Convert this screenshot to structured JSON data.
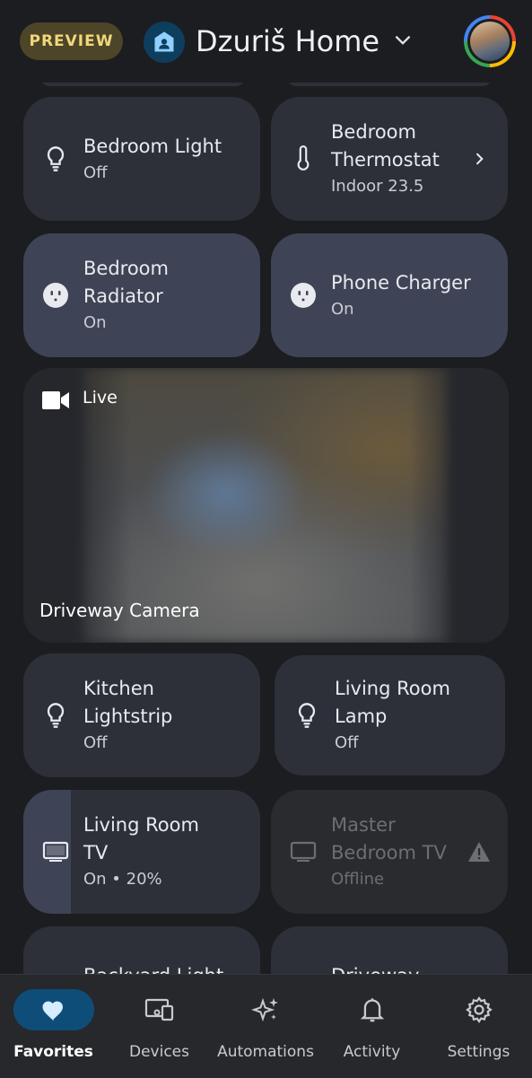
{
  "header": {
    "preview_label": "PREVIEW",
    "home_name": "Dzuriš Home",
    "home_icon": "home-person-icon",
    "menu_icon": "chevron-down-icon"
  },
  "tiles": [
    {
      "name": "Bedroom Light",
      "status": "Off",
      "icon": "lightbulb-icon",
      "state": "off"
    },
    {
      "name": "Bedroom Thermostat",
      "status": "Indoor 23.5",
      "icon": "thermometer-icon",
      "state": "off",
      "chevron": "chevron-right-icon"
    },
    {
      "name": "Bedroom Radiator",
      "status": "On",
      "icon": "outlet-icon",
      "state": "on"
    },
    {
      "name": "Phone Charger",
      "status": "On",
      "icon": "outlet-icon",
      "state": "on"
    },
    {
      "name": "Kitchen Lightstrip",
      "status": "Off",
      "icon": "lightbulb-icon",
      "state": "off"
    },
    {
      "name": "Living Room Lamp",
      "status": "Off",
      "icon": "lightbulb-icon",
      "state": "off"
    },
    {
      "name": "Living Room TV",
      "status": "On • 20%",
      "icon": "tv-icon",
      "state": "on",
      "level_percent": 20
    },
    {
      "name": "Master Bedroom TV",
      "status": "Offline",
      "icon": "tv-icon",
      "state": "offline",
      "alert_icon": "warning-icon"
    },
    {
      "name": "Backyard Light",
      "status": "",
      "icon": "lightbulb-icon",
      "state": "off"
    },
    {
      "name": "Driveway Lights",
      "status": "",
      "icon": "lightbulb-icon",
      "state": "off"
    }
  ],
  "camera": {
    "live_label": "Live",
    "name": "Driveway Camera",
    "icon": "video-camera-icon"
  },
  "nav": [
    {
      "label": "Favorites",
      "icon": "heart-icon",
      "active": true
    },
    {
      "label": "Devices",
      "icon": "devices-icon",
      "active": false
    },
    {
      "label": "Automations",
      "icon": "sparkle-icon",
      "active": false
    },
    {
      "label": "Activity",
      "icon": "bell-icon",
      "active": false
    },
    {
      "label": "Settings",
      "icon": "gear-icon",
      "active": false
    }
  ],
  "colors": {
    "background": "#1c1d20",
    "tile_off": "#2d3039",
    "tile_on": "#3e4456",
    "preview_text": "#f0d77a",
    "nav_active": "#0e4d78"
  }
}
